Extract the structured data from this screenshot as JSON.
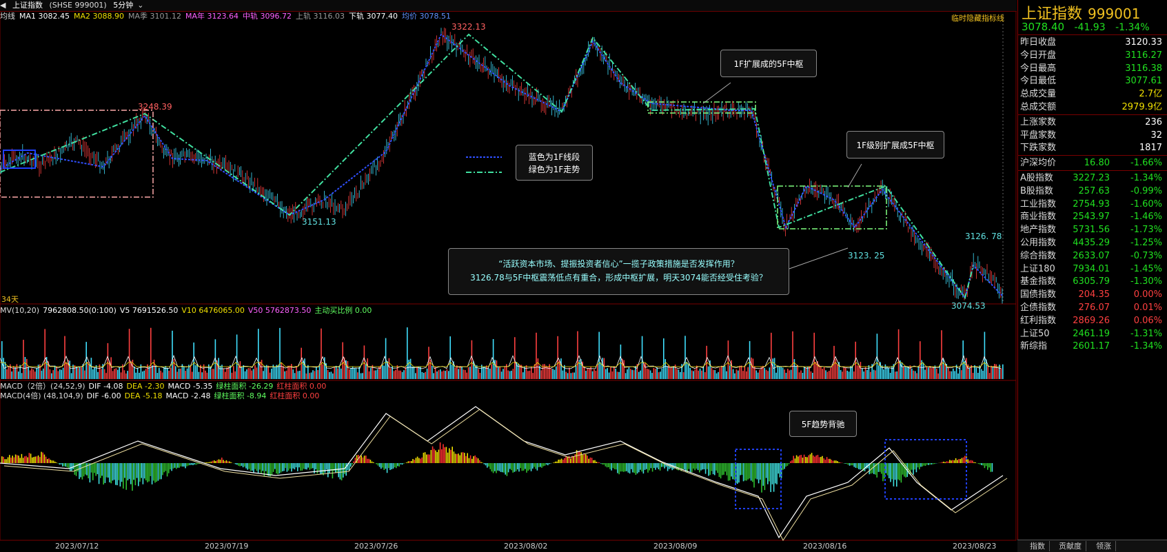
{
  "header": {
    "name": "上证指数",
    "code": "(SHSE 999001)",
    "period": "5分钟",
    "right_text": "临时隐藏指标线"
  },
  "ma_bar": {
    "items": [
      {
        "label": "均线",
        "color": "#dddddd"
      },
      {
        "label": "MA1 3082.45",
        "color": "#ffffff"
      },
      {
        "label": "MA2 3088.90",
        "color": "#f0e000"
      },
      {
        "label": "MA季 3101.12",
        "color": "#999999"
      },
      {
        "label": "MA年 3123.64",
        "color": "#ff60ff"
      },
      {
        "label": "中轨 3096.72",
        "color": "#ff60ff"
      },
      {
        "label": "上轨 3116.03",
        "color": "#999999"
      },
      {
        "label": "下轨 3077.40",
        "color": "#ffffff"
      },
      {
        "label": "均价 3078.51",
        "color": "#6090ff"
      }
    ]
  },
  "main_chart": {
    "price_labels": [
      {
        "text": "3322.13",
        "color": "#ff6060"
      },
      {
        "text": "3248.39",
        "color": "#ff6060"
      },
      {
        "text": "3151.13",
        "color": "#60e0e0"
      },
      {
        "text": "3126. 78",
        "color": "#60e0e0"
      },
      {
        "text": "3123. 25",
        "color": "#60e0e0"
      },
      {
        "text": "3074.53",
        "color": "#60e0e0"
      }
    ],
    "days_label": "34天",
    "notes": {
      "note1": "1F扩展成的5F中枢",
      "note2": "1F级别扩展成5F中枢",
      "legend_line1": "蓝色为1F线段",
      "legend_line2": "绿色为1F走势",
      "policy_line1": "“活跃资本市场、提振投资者信心”一揽子政策措施是否发挥作用？",
      "policy_line2": "3126.78与5F中枢震荡低点有重合，形成中枢扩展，明天3074能否经受住考验？",
      "divergence": "5F趋势背驰"
    }
  },
  "volume": {
    "items": [
      {
        "label": "MV(10,20)",
        "color": "#dddddd"
      },
      {
        "label": "7962808.50(0:100)",
        "color": "#ffffff"
      },
      {
        "label": "V5 7691526.50",
        "color": "#ffffff"
      },
      {
        "label": "V10 6476065.00",
        "color": "#f0e000"
      },
      {
        "label": "V50 5762873.50",
        "color": "#ff60ff"
      },
      {
        "label": "主动买比例 0.00",
        "color": "#60ff60"
      }
    ]
  },
  "macd1": {
    "items": [
      {
        "label": "MACD（2倍）(24,52,9)",
        "color": "#dddddd"
      },
      {
        "label": "DIF -4.08",
        "color": "#ffffff"
      },
      {
        "label": "DEA -2.30",
        "color": "#f0e000"
      },
      {
        "label": "MACD -5.35",
        "color": "#ffffff"
      },
      {
        "label": "绿柱面积 -26.29",
        "color": "#60ff60"
      },
      {
        "label": "红柱面积 0.00",
        "color": "#ff4040"
      }
    ]
  },
  "macd2": {
    "items": [
      {
        "label": "MACD(4倍) (48,104,9)",
        "color": "#dddddd"
      },
      {
        "label": "DIF -6.00",
        "color": "#ffffff"
      },
      {
        "label": "DEA -5.18",
        "color": "#f0e000"
      },
      {
        "label": "MACD -2.48",
        "color": "#ffffff"
      },
      {
        "label": "绿柱面积 -8.94",
        "color": "#60ff60"
      },
      {
        "label": "红柱面积 0.00",
        "color": "#ff4040"
      }
    ]
  },
  "x_axis": [
    "2023/07/12",
    "2023/07/19",
    "2023/07/26",
    "2023/08/02",
    "2023/08/09",
    "2023/08/16",
    "2023/08/23"
  ],
  "right_panel": {
    "title": "上证指数",
    "code": "999001",
    "price": "3078.40",
    "change": "-41.93",
    "change_pct": "-1.34%",
    "stats": [
      {
        "label": "昨日收盘",
        "value": "3120.33",
        "color": "#ffffff"
      },
      {
        "label": "今日开盘",
        "value": "3116.27",
        "color": "#20e020"
      },
      {
        "label": "今日最高",
        "value": "3116.38",
        "color": "#20e020"
      },
      {
        "label": "今日最低",
        "value": "3077.61",
        "color": "#20e020"
      },
      {
        "label": "总成交量",
        "value": "2.7亿",
        "color": "#f0e000"
      },
      {
        "label": "总成交额",
        "value": "2979.9亿",
        "color": "#f0e000"
      }
    ],
    "counts": [
      {
        "label": "上涨家数",
        "value": "236",
        "color": "#ffffff"
      },
      {
        "label": "平盘家数",
        "value": "32",
        "color": "#ffffff"
      },
      {
        "label": "下跌家数",
        "value": "1817",
        "color": "#ffffff"
      }
    ],
    "hs_avg": {
      "label": "沪深均价",
      "value": "16.80",
      "pct": "-1.66%"
    },
    "indices": [
      {
        "label": "A股指数",
        "value": "3227.23",
        "pct": "-1.34%",
        "color": "#20e020"
      },
      {
        "label": "B股指数",
        "value": "257.63",
        "pct": "-0.99%",
        "color": "#20e020"
      },
      {
        "label": "工业指数",
        "value": "2754.93",
        "pct": "-1.60%",
        "color": "#20e020"
      },
      {
        "label": "商业指数",
        "value": "2543.97",
        "pct": "-1.46%",
        "color": "#20e020"
      },
      {
        "label": "地产指数",
        "value": "5731.56",
        "pct": "-1.73%",
        "color": "#20e020"
      },
      {
        "label": "公用指数",
        "value": "4435.29",
        "pct": "-1.25%",
        "color": "#20e020"
      },
      {
        "label": "综合指数",
        "value": "2633.07",
        "pct": "-0.73%",
        "color": "#20e020"
      },
      {
        "label": "上证180",
        "value": "7934.01",
        "pct": "-1.45%",
        "color": "#20e020"
      },
      {
        "label": "基金指数",
        "value": "6305.79",
        "pct": "-1.30%",
        "color": "#20e020"
      },
      {
        "label": "国债指数",
        "value": "204.35",
        "pct": "0.00%",
        "color": "#ff4040"
      },
      {
        "label": "企债指数",
        "value": "276.07",
        "pct": "0.01%",
        "color": "#ff4040"
      },
      {
        "label": "红利指数",
        "value": "2869.26",
        "pct": "0.06%",
        "color": "#ff4040"
      },
      {
        "label": "上证50",
        "value": "2461.19",
        "pct": "-1.31%",
        "color": "#20e020"
      },
      {
        "label": "新综指",
        "value": "2601.17",
        "pct": "-1.34%",
        "color": "#20e020"
      }
    ],
    "tabs": [
      "指数",
      "贡献度",
      "领涨"
    ]
  }
}
